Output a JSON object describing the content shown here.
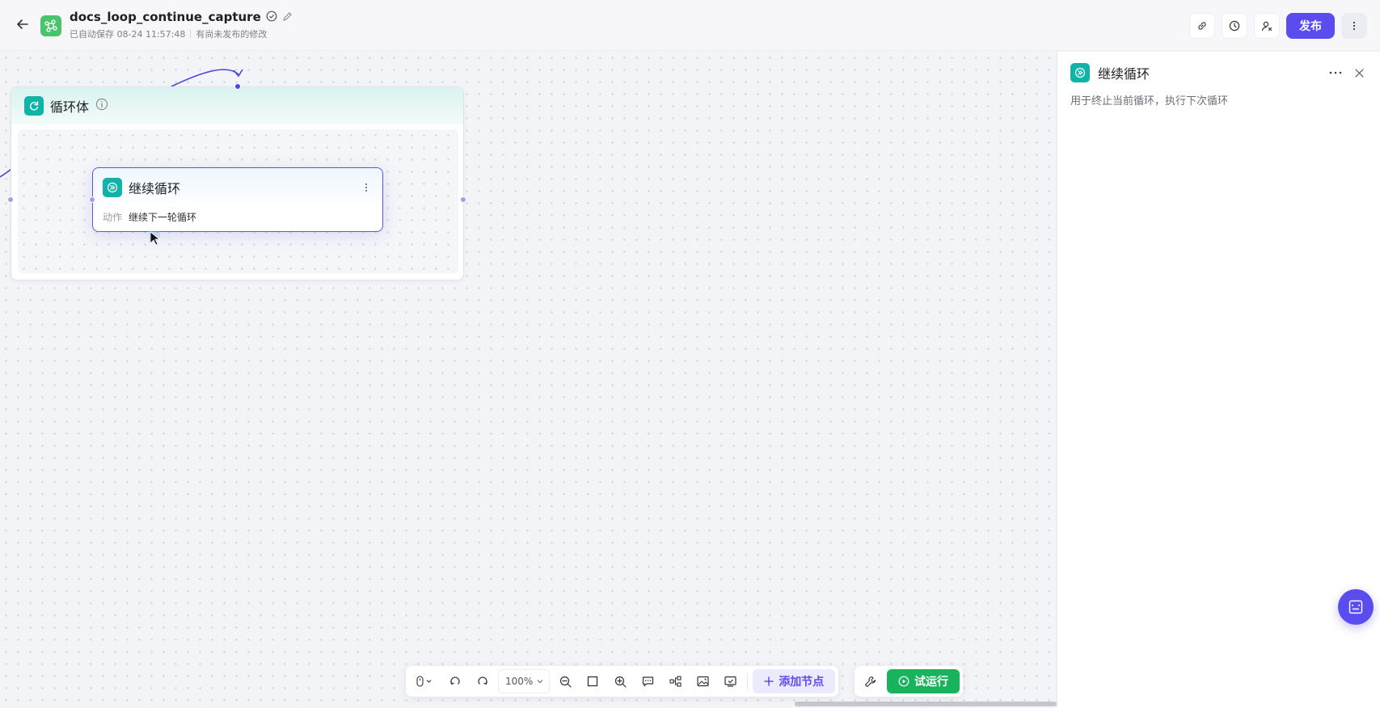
{
  "header": {
    "title": "docs_loop_continue_capture",
    "autosave": "已自动保存 08-24 11:57:48",
    "unpublished": "有尚未发布的修改",
    "publish_label": "发布"
  },
  "canvas": {
    "loop_body": {
      "title": "循环体"
    },
    "node": {
      "title": "继续循环",
      "field_label": "动作",
      "field_value": "继续下一轮循环"
    }
  },
  "toolbar": {
    "zoom": "100%",
    "add_node_label": "添加节点",
    "run_label": "试运行"
  },
  "panel": {
    "title": "继续循环",
    "description": "用于终止当前循环，执行下次循环"
  },
  "colors": {
    "accent": "#5b4cf0",
    "teal": "#11b3a8",
    "green": "#19b35e"
  }
}
